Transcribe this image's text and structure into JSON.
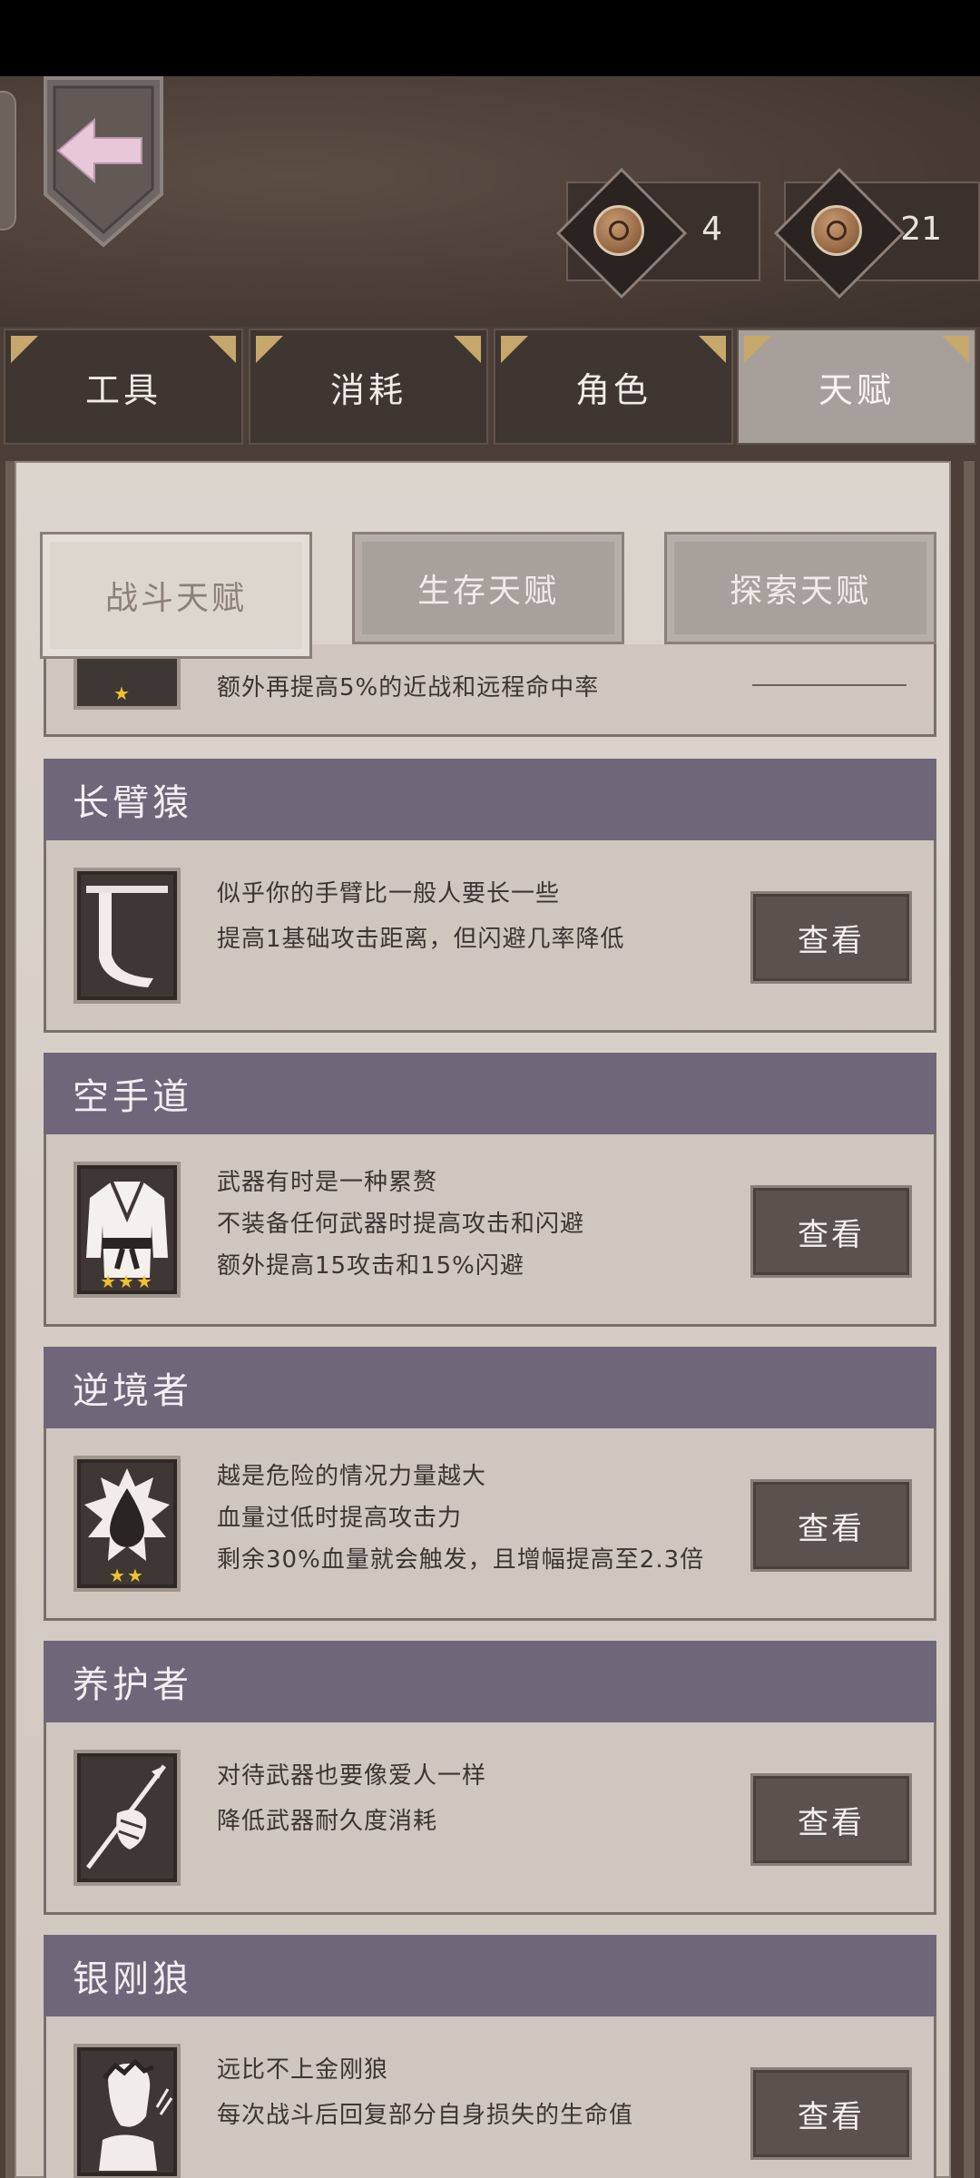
{
  "currencies": [
    {
      "value": "4",
      "icon": "coin-icon"
    },
    {
      "value": "21",
      "icon": "coin-icon"
    }
  ],
  "tabs": [
    {
      "label": "工具",
      "active": false
    },
    {
      "label": "消耗",
      "active": false
    },
    {
      "label": "角色",
      "active": false
    },
    {
      "label": "天赋",
      "active": true
    }
  ],
  "subtabs": [
    {
      "label": "战斗天赋",
      "active": true
    },
    {
      "label": "生存天赋",
      "active": false
    },
    {
      "label": "探索天赋",
      "active": false
    }
  ],
  "partial_card": {
    "description": "额外再提高5%的近战和远程命中率"
  },
  "talents": [
    {
      "name": "长臂猿",
      "icon": "long-arm-icon",
      "stars": "",
      "lines": [
        "似乎你的手臂比一般人要长一些",
        "提高1基础攻击距离，但闪避几率降低"
      ],
      "button": "查看"
    },
    {
      "name": "空手道",
      "icon": "karate-gi-icon",
      "stars": "★★★",
      "lines": [
        "武器有时是一种累赘",
        "不装备任何武器时提高攻击和闪避",
        "额外提高15攻击和15%闪避"
      ],
      "button": "查看"
    },
    {
      "name": "逆境者",
      "icon": "blood-drop-icon",
      "stars": "★★",
      "lines": [
        "越是危险的情况力量越大",
        "血量过低时提高攻击力",
        "剩余30%血量就会触发，且增幅提高至2.3倍"
      ],
      "button": "查看"
    },
    {
      "name": "养护者",
      "icon": "wrapped-spear-icon",
      "stars": "",
      "lines": [
        "对待武器也要像爱人一样",
        "降低武器耐久度消耗"
      ],
      "button": "查看"
    },
    {
      "name": "银刚狼",
      "icon": "wolverine-icon",
      "stars": "",
      "lines": [
        "远比不上金刚狼",
        "每次战斗后回复部分自身损失的生命值"
      ],
      "button": "查看"
    }
  ]
}
